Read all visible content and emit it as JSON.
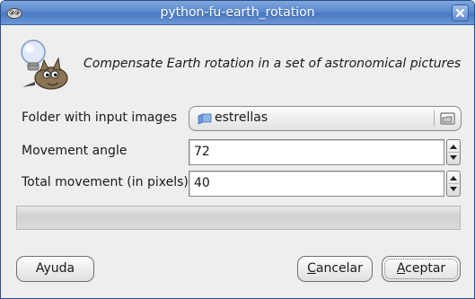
{
  "window": {
    "title": "python-fu-earth_rotation",
    "menu_icon": "gimp-window-menu-icon",
    "close_icon": "close-icon"
  },
  "header": {
    "icon": "gimp-wilber-lightbulb-icon",
    "description": "Compensate Earth rotation in a set of astronomical pictures"
  },
  "fields": {
    "folder": {
      "label": "Folder with input images",
      "value": "estrellas",
      "icon": "folder-icon",
      "open_icon": "open-folder-icon"
    },
    "angle": {
      "label": "Movement angle",
      "value": "72"
    },
    "total": {
      "label": "Total movement (in pixels)",
      "value": "40"
    }
  },
  "progress": {
    "value": 0
  },
  "buttons": {
    "help": "Ayuda",
    "cancel": {
      "mnemonic": "C",
      "rest": "ancelar"
    },
    "accept": {
      "mnemonic": "A",
      "rest": "ceptar"
    }
  },
  "colors": {
    "titlebar": "#5a89cf",
    "folder_icon": "#6a9ad8"
  }
}
